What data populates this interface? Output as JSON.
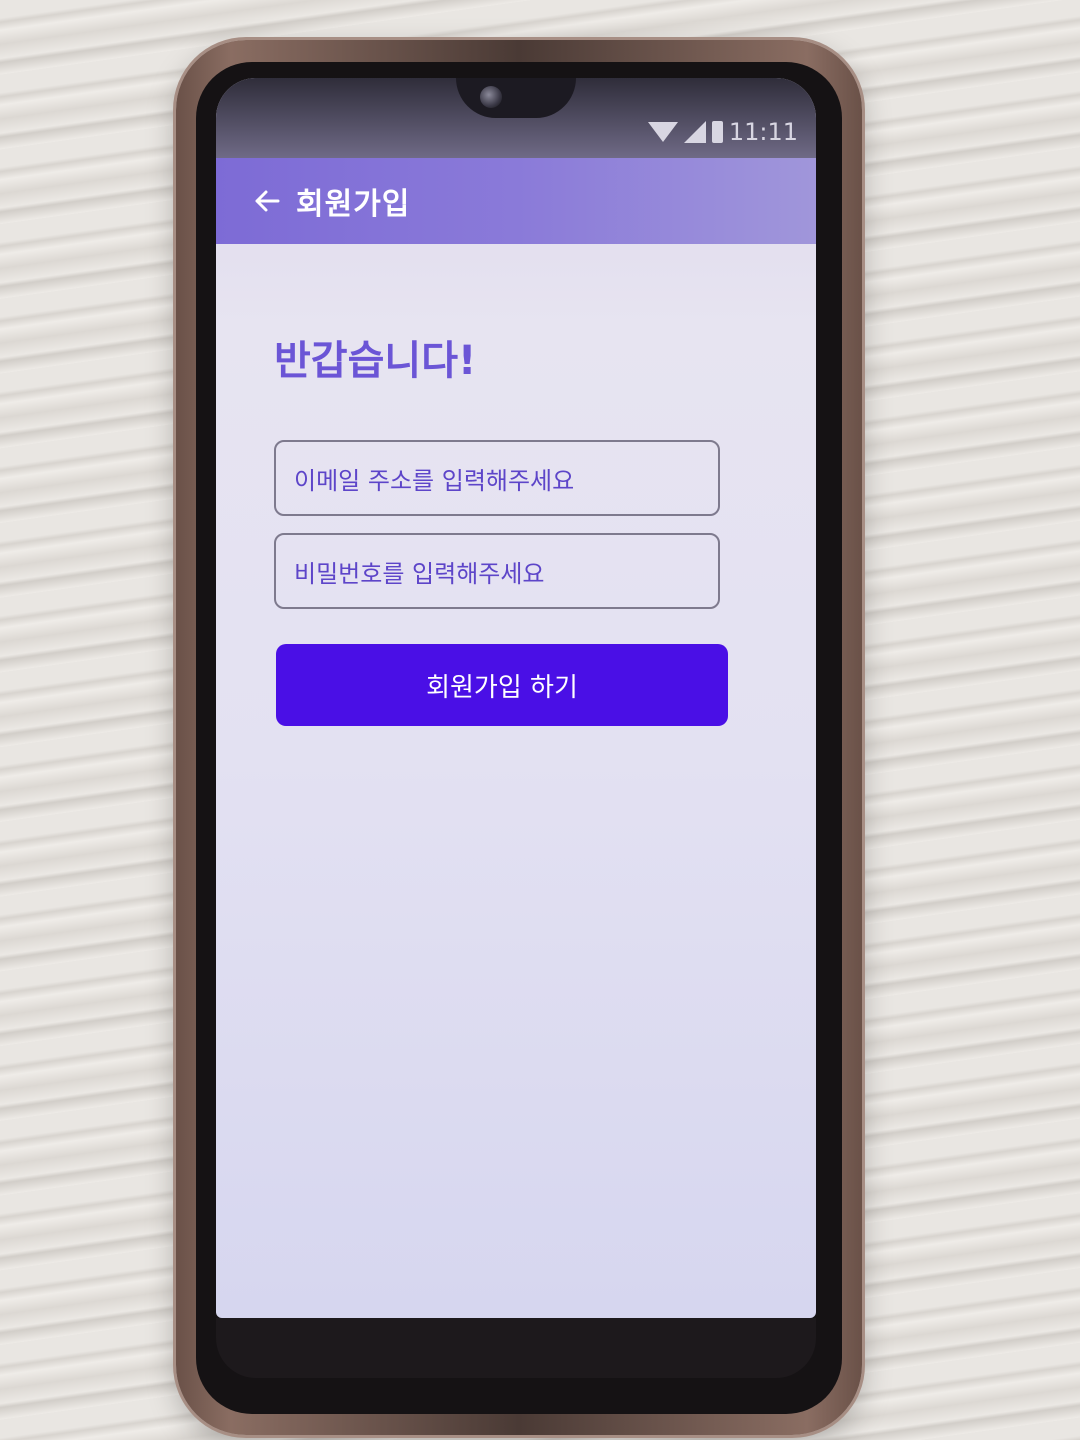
{
  "status_bar": {
    "time": "11:11",
    "icons": [
      "wifi-icon",
      "signal-icon",
      "battery-icon"
    ]
  },
  "app_bar": {
    "back_icon": "arrow-left-icon",
    "title": "회원가입"
  },
  "main": {
    "greeting": "반갑습니다!",
    "email_placeholder": "이메일 주소를 입력해주세요",
    "password_placeholder": "비밀번호를 입력해주세요",
    "signup_button_label": "회원가입 하기"
  },
  "colors": {
    "app_bar": "#8a7ad9",
    "accent": "#4a0fe6",
    "greeting_text": "#6b55d6",
    "screen_background": "#e3e1f2"
  }
}
